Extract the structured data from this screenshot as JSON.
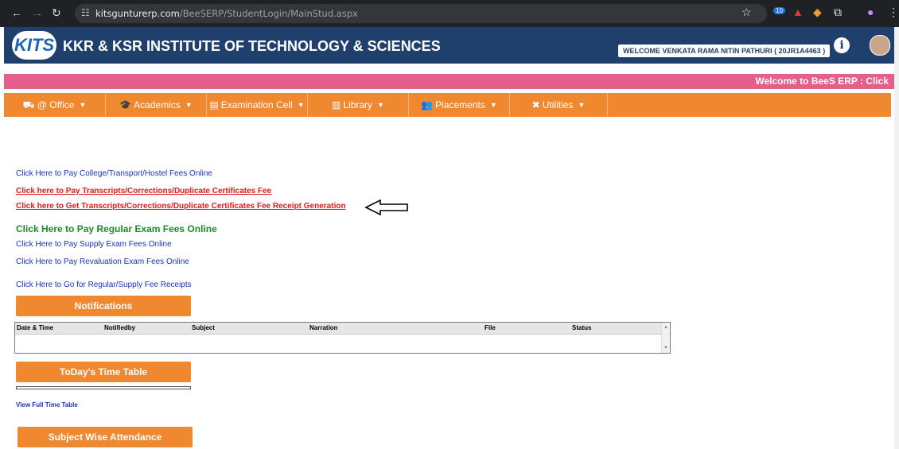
{
  "browser": {
    "url_host": "kitsgunturerp.com",
    "url_path": "/BeeSERP/StudentLogin/MainStud.aspx",
    "extension_badge": "10"
  },
  "header": {
    "logo_text": "KITS",
    "title": "KKR & KSR INSTITUTE OF TECHNOLOGY & SCIENCES",
    "welcome": "WELCOME VENKATA RAMA NITIN PATHURI ( 20JR1A4463 )"
  },
  "marquee": "Welcome to BeeS ERP : Click",
  "menu": [
    {
      "label": "@ Office",
      "icon": "car-icon"
    },
    {
      "label": "Academics",
      "icon": "graduation-cap-icon"
    },
    {
      "label": "Examination Cell",
      "icon": "document-icon"
    },
    {
      "label": "Library",
      "icon": "book-icon"
    },
    {
      "label": "Placements",
      "icon": "users-icon"
    },
    {
      "label": "Utilities",
      "icon": "tools-icon"
    }
  ],
  "links": {
    "college_fees": "Click Here to Pay College/Transport/Hostel Fees Online",
    "transcripts_fee": "Click here to Pay Transcripts/Corrections/Duplicate Certificates Fee",
    "transcripts_receipt": "Click here to Get Transcripts/Corrections/Duplicate Certificates Fee Receipt Generation",
    "regular_exam": "Click Here to Pay Regular Exam Fees Online",
    "supply_exam": "Click Here to Pay Supply Exam Fees Online",
    "revaluation": "Click Here to Pay Revaluation Exam Fees Online",
    "fee_receipts": "Click Here to Go for Regular/Supply Fee Receipts"
  },
  "notifications": {
    "button": "Notifications",
    "columns": [
      "Date & Time",
      "Notifiedby",
      "Subject",
      "Narration",
      "File",
      "Status"
    ]
  },
  "timetable": {
    "button": "ToDay's Time Table",
    "view_full": "View Full Time Table"
  },
  "attendance_button": "Subject Wise Attendance",
  "colors": {
    "header_bg": "#1f3f6d",
    "marquee_bg": "#e4608b",
    "menu_bg": "#f0882f",
    "link_blue": "#1a33c4",
    "link_red": "#e01b1b",
    "link_green": "#1e8a2c"
  }
}
